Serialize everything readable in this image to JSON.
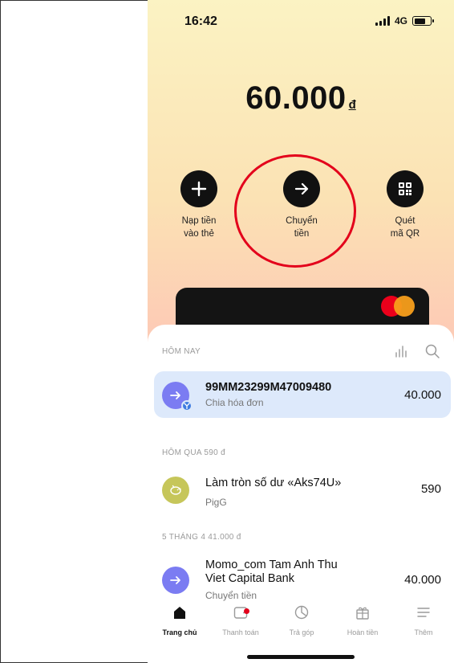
{
  "status_bar": {
    "time": "16:42",
    "network": "4G"
  },
  "balance": {
    "amount": "60.000",
    "currency": "đ"
  },
  "actions": [
    {
      "line1": "Nạp tiền",
      "line2": "vào thẻ",
      "icon": "plus-icon"
    },
    {
      "line1": "Chuyển",
      "line2": "tiền",
      "icon": "arrow-right-icon"
    },
    {
      "line1": "Quét",
      "line2": "mã QR",
      "icon": "qr-icon"
    }
  ],
  "sections": {
    "today": "HÔM NAY",
    "yesterday": "HÔM QUA 590 đ",
    "april": "5 THÁNG 4 41.000 đ"
  },
  "transactions": [
    {
      "name": "99MM23299M47009480",
      "subtitle": "Chia hóa đơn",
      "amount": "40.000",
      "icon": "arrow-right-icon",
      "icon_color": "#7b7cf2"
    },
    {
      "name": "Làm tròn số dư «Aks74U»",
      "subtitle": "PigG",
      "amount": "590",
      "icon": "piggy-icon",
      "icon_color": "#c6c65a"
    },
    {
      "name_line1": "Momo_com Tam Anh Thu",
      "name_line2": "Viet Capital Bank",
      "subtitle": "Chuyển tiền",
      "amount": "40.000",
      "icon": "arrow-right-icon",
      "icon_color": "#7b7cf2"
    }
  ],
  "nav": [
    {
      "label": "Trang chủ",
      "icon": "home-icon",
      "active": true
    },
    {
      "label": "Thanh toán",
      "icon": "wallet-icon",
      "active": false
    },
    {
      "label": "Trả góp",
      "icon": "pie-chart-icon",
      "active": false
    },
    {
      "label": "Hoàn tiền",
      "icon": "gift-icon",
      "active": false
    },
    {
      "label": "Thêm",
      "icon": "menu-icon",
      "active": false
    }
  ],
  "colors": {
    "highlight": "#e3001b",
    "accent": "#7b7cf2",
    "active_row": "#dde9fb"
  }
}
